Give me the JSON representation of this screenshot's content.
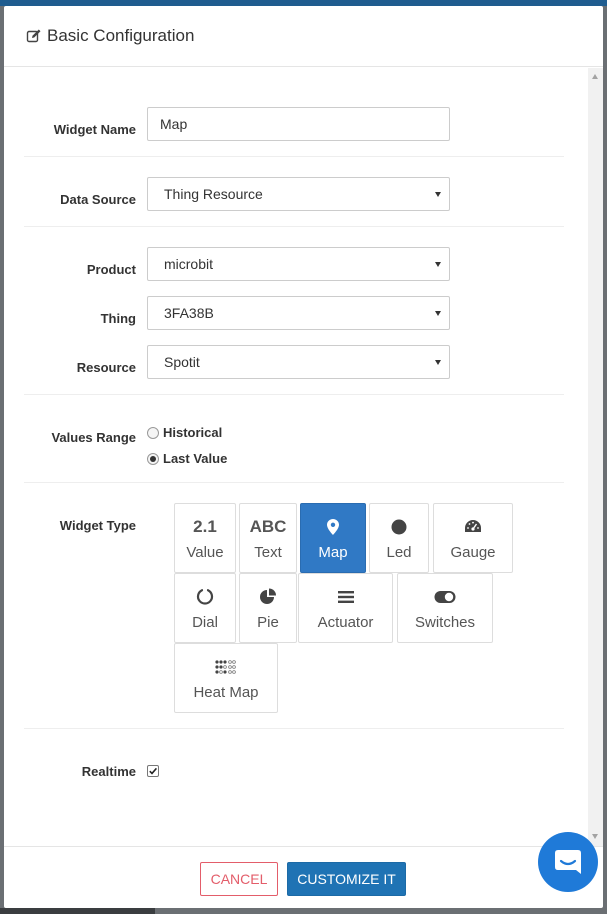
{
  "modal": {
    "title": "Basic Configuration",
    "icon": "edit-icon"
  },
  "form": {
    "widget_name": {
      "label": "Widget Name",
      "value": "Map"
    },
    "data_source": {
      "label": "Data Source",
      "value": "Thing Resource"
    },
    "product": {
      "label": "Product",
      "value": "microbit"
    },
    "thing": {
      "label": "Thing",
      "value": "3FA38B"
    },
    "resource": {
      "label": "Resource",
      "value": "Spotit"
    },
    "values_range": {
      "label": "Values Range",
      "options": [
        {
          "label": "Historical",
          "checked": false
        },
        {
          "label": "Last Value",
          "checked": true
        }
      ]
    },
    "widget_type": {
      "label": "Widget Type",
      "tiles": [
        {
          "label": "Value",
          "glyph": "2.1",
          "icon": "value-icon",
          "active": false
        },
        {
          "label": "Text",
          "glyph": "ABC",
          "icon": "text-icon",
          "active": false
        },
        {
          "label": "Map",
          "icon": "map-marker-icon",
          "active": true
        },
        {
          "label": "Led",
          "icon": "circle-icon",
          "active": false
        },
        {
          "label": "Gauge",
          "icon": "gauge-icon",
          "active": false
        },
        {
          "label": "Dial",
          "icon": "circle-notch-icon",
          "active": false
        },
        {
          "label": "Pie",
          "icon": "pie-chart-icon",
          "active": false
        },
        {
          "label": "Actuator",
          "icon": "bars-icon",
          "active": false
        },
        {
          "label": "Switches",
          "icon": "toggle-icon",
          "active": false
        },
        {
          "label": "Heat Map",
          "icon": "heat-map-icon",
          "active": false
        }
      ]
    },
    "realtime": {
      "label": "Realtime",
      "checked": true
    }
  },
  "footer": {
    "cancel_label": "CANCEL",
    "customize_label": "CUSTOMIZE IT"
  },
  "colors": {
    "primary": "#1f73b4",
    "active_tile": "#3079c5",
    "danger": "#e35d6a",
    "chat": "#1f7ad8"
  }
}
